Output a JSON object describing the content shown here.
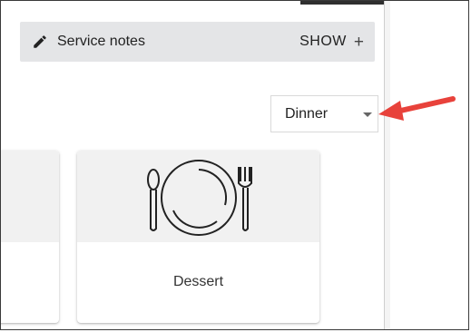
{
  "notes_bar": {
    "title": "Service notes",
    "action_label": "SHOW",
    "action_icon": "+",
    "leading_icon": "pencil-icon",
    "background": "#e4e5e7"
  },
  "meal_select": {
    "value": "Dinner",
    "icon": "caret-down-icon"
  },
  "annotation": {
    "icon": "red-arrow-icon",
    "color": "#e8423b"
  },
  "cards": [
    {
      "label": "",
      "partial": true
    },
    {
      "label": "Dessert",
      "icon": "place-setting-icon"
    }
  ]
}
